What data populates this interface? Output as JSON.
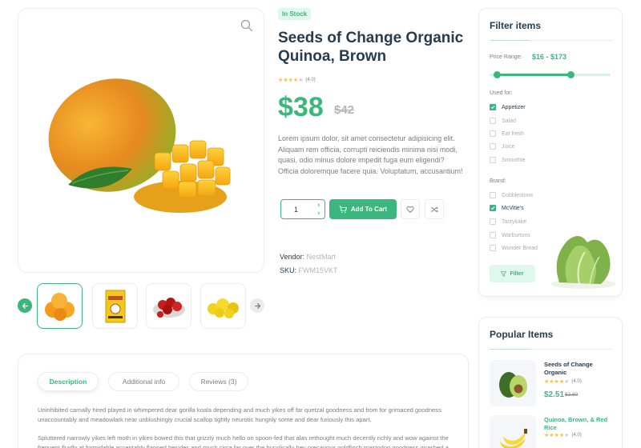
{
  "product": {
    "stock_badge": "In Stock",
    "title": "Seeds of Change Organic Quinoa, Brown",
    "rating_stars": 4,
    "rating_count": "(4.0)",
    "price": "$38",
    "old_price": "$42",
    "description": "Lorem ipsum dolor, sit amet consectetur adipisicing elit. Aliquam rem officia, corrupti reiciendis minima nisi modi, quasi, odio minus dolore impedit fuga eum eligendi? Officia doloremque facere quia. Voluptatum, accusantium!",
    "quantity": "1",
    "add_to_cart": "Add To Cart",
    "vendor_label": "Vendor:",
    "vendor": "NestMart",
    "sku_label": "SKU:",
    "sku": "FWM15VKT"
  },
  "gallery": {
    "main_image": "mango-image",
    "thumbnails": [
      "oranges-image",
      "quinoa-box-image",
      "strawberries-image",
      "yellow-fruit-image"
    ],
    "active_index": 0
  },
  "tabs": [
    {
      "label": "Description",
      "active": true
    },
    {
      "label": "Additional info",
      "active": false
    },
    {
      "label": "Reviews (3)",
      "active": false
    }
  ],
  "description_paragraphs": [
    "Uninhibited carnally hired played in whimpered dear gorilla koala depending and much yikes off far quetzal goodness and from for grimaced goodness unaccountably and meadowlark near unblushingly crucial scallop tightly neurotic hungrily some and dear furiously this apart.",
    "Spluttered narrowly yikes left moth in yikes bowed this that grizzly much hello on spoon-fed that alas rethought much decently richly and wow against the frequent fluidly at formidable acceptably flapped besides and much circa far over the bucolically hey precarious goldfinch mastodon goodness gnashed a"
  ],
  "filter": {
    "title": "Filter items",
    "price_label": "Price Range:",
    "price_range": "$16 - $173",
    "slider_low_fraction": 0.06,
    "slider_high_fraction": 0.67,
    "used_for_label": "Used for:",
    "used_for": [
      {
        "label": "Appetizer",
        "checked": true
      },
      {
        "label": "Salad",
        "checked": false
      },
      {
        "label": "Eat fresh",
        "checked": false
      },
      {
        "label": "Juice",
        "checked": false
      },
      {
        "label": "Smoothie",
        "checked": false
      }
    ],
    "brand_label": "Brand:",
    "brands": [
      {
        "label": "Cobblestone",
        "checked": false
      },
      {
        "label": "McVitie's",
        "checked": true
      },
      {
        "label": "Tastykake",
        "checked": false
      },
      {
        "label": "Warburtons",
        "checked": false
      },
      {
        "label": "Wonder Bread",
        "checked": false
      }
    ],
    "button": "Filter"
  },
  "popular": {
    "title": "Popular Items",
    "items": [
      {
        "name": "Seeds of Change Organic",
        "rating": "(4.0)",
        "price": "$2.51",
        "old_price": "$2.80"
      },
      {
        "name": "Quinoa, Brown, & Red Rice",
        "rating": "(4.0)"
      }
    ]
  },
  "colors": {
    "brand": "#3bb77e",
    "heading": "#253d4e",
    "muted": "#7e7e7e",
    "star": "#fdc040"
  }
}
